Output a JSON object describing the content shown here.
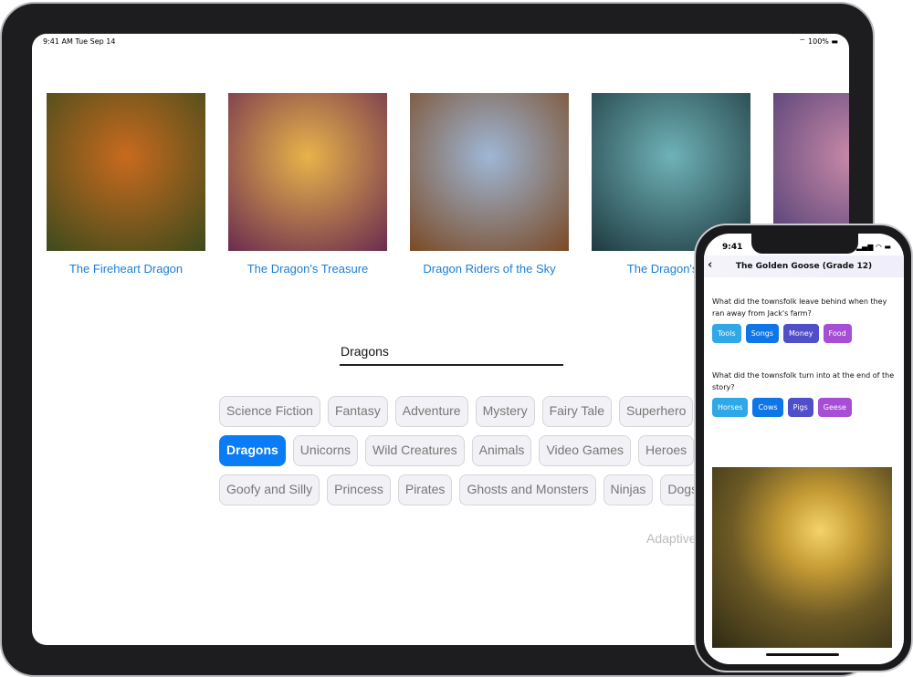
{
  "tablet": {
    "status": {
      "time": "9:41 AM  Tue Sep 14",
      "battery": "100%"
    },
    "books": [
      {
        "title": "The Fireheart Dragon",
        "colors": [
          "#c96a1e",
          "#3d4a1c"
        ]
      },
      {
        "title": "The Dragon's Treasure",
        "colors": [
          "#e8b34a",
          "#6a2c50"
        ]
      },
      {
        "title": "Dragon Riders of the Sky",
        "colors": [
          "#9eb7d6",
          "#7a4a25"
        ]
      },
      {
        "title": "The Dragon's Ap",
        "colors": [
          "#6fb2b8",
          "#1e3a3f"
        ]
      },
      {
        "title": "",
        "colors": [
          "#c98aa8",
          "#4b3b73"
        ]
      }
    ],
    "search_value": "Dragons",
    "tag_rows": [
      [
        "Science Fiction",
        "Fantasy",
        "Adventure",
        "Mystery",
        "Fairy Tale",
        "Superhero"
      ],
      [
        "Dragons",
        "Unicorns",
        "Wild Creatures",
        "Animals",
        "Video Games",
        "Heroes"
      ],
      [
        "Goofy and Silly",
        "Princess",
        "Pirates",
        "Ghosts and Monsters",
        "Ninjas",
        "Dogs"
      ]
    ],
    "selected_tag": "Dragons",
    "footer_text": "Adaptive"
  },
  "phone": {
    "time": "9:41",
    "title": "The Golden Goose (Grade 12)",
    "questions": [
      {
        "text": "What did the townsfolk leave behind when they ran away from Jack's farm?",
        "options": [
          "Tools",
          "Songs",
          "Money",
          "Food"
        ]
      },
      {
        "text": "What did the townsfolk turn into at the end of the story?",
        "options": [
          "Horses",
          "Cows",
          "Pigs",
          "Geese"
        ]
      }
    ],
    "option_colors": [
      "#2ea8e6",
      "#0f76e8",
      "#4f4fc9",
      "#a64fd6"
    ]
  }
}
